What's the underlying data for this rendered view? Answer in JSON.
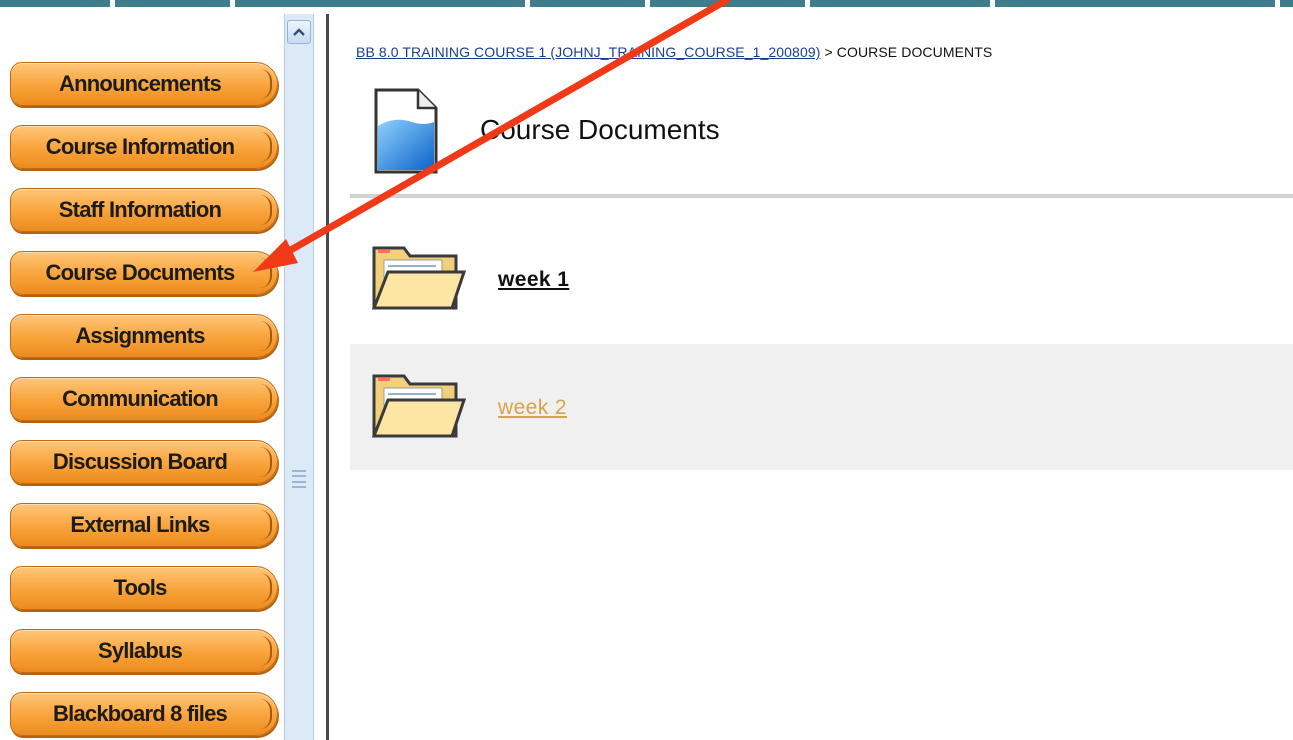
{
  "breadcrumb": {
    "course_link": "BB 8.0 TRAINING COURSE 1 (JOHNJ_TRAINING_COURSE_1_200809)",
    "separator": " > ",
    "current": "COURSE DOCUMENTS"
  },
  "page": {
    "title": "Course Documents",
    "icon": "document-icon"
  },
  "sidebar": {
    "items": [
      {
        "label": "Announcements"
      },
      {
        "label": "Course Information"
      },
      {
        "label": "Staff Information"
      },
      {
        "label": "Course Documents"
      },
      {
        "label": "Assignments"
      },
      {
        "label": "Communication"
      },
      {
        "label": "Discussion Board"
      },
      {
        "label": "External Links"
      },
      {
        "label": "Tools"
      },
      {
        "label": "Syllabus"
      },
      {
        "label": "Blackboard 8 files"
      }
    ]
  },
  "folders": [
    {
      "label": "week 1",
      "icon": "folder-icon",
      "state": "normal"
    },
    {
      "label": "week 2",
      "icon": "folder-icon",
      "state": "visited"
    }
  ],
  "colors": {
    "button": "#f9a33a",
    "visited_link": "#d6a448",
    "breadcrumb_link": "#1a3e8f",
    "annotation_arrow": "#f03a17",
    "topbar": "#3f7d8c"
  },
  "annotation": {
    "type": "arrow",
    "points_to": "sidebar-item-course-documents"
  }
}
